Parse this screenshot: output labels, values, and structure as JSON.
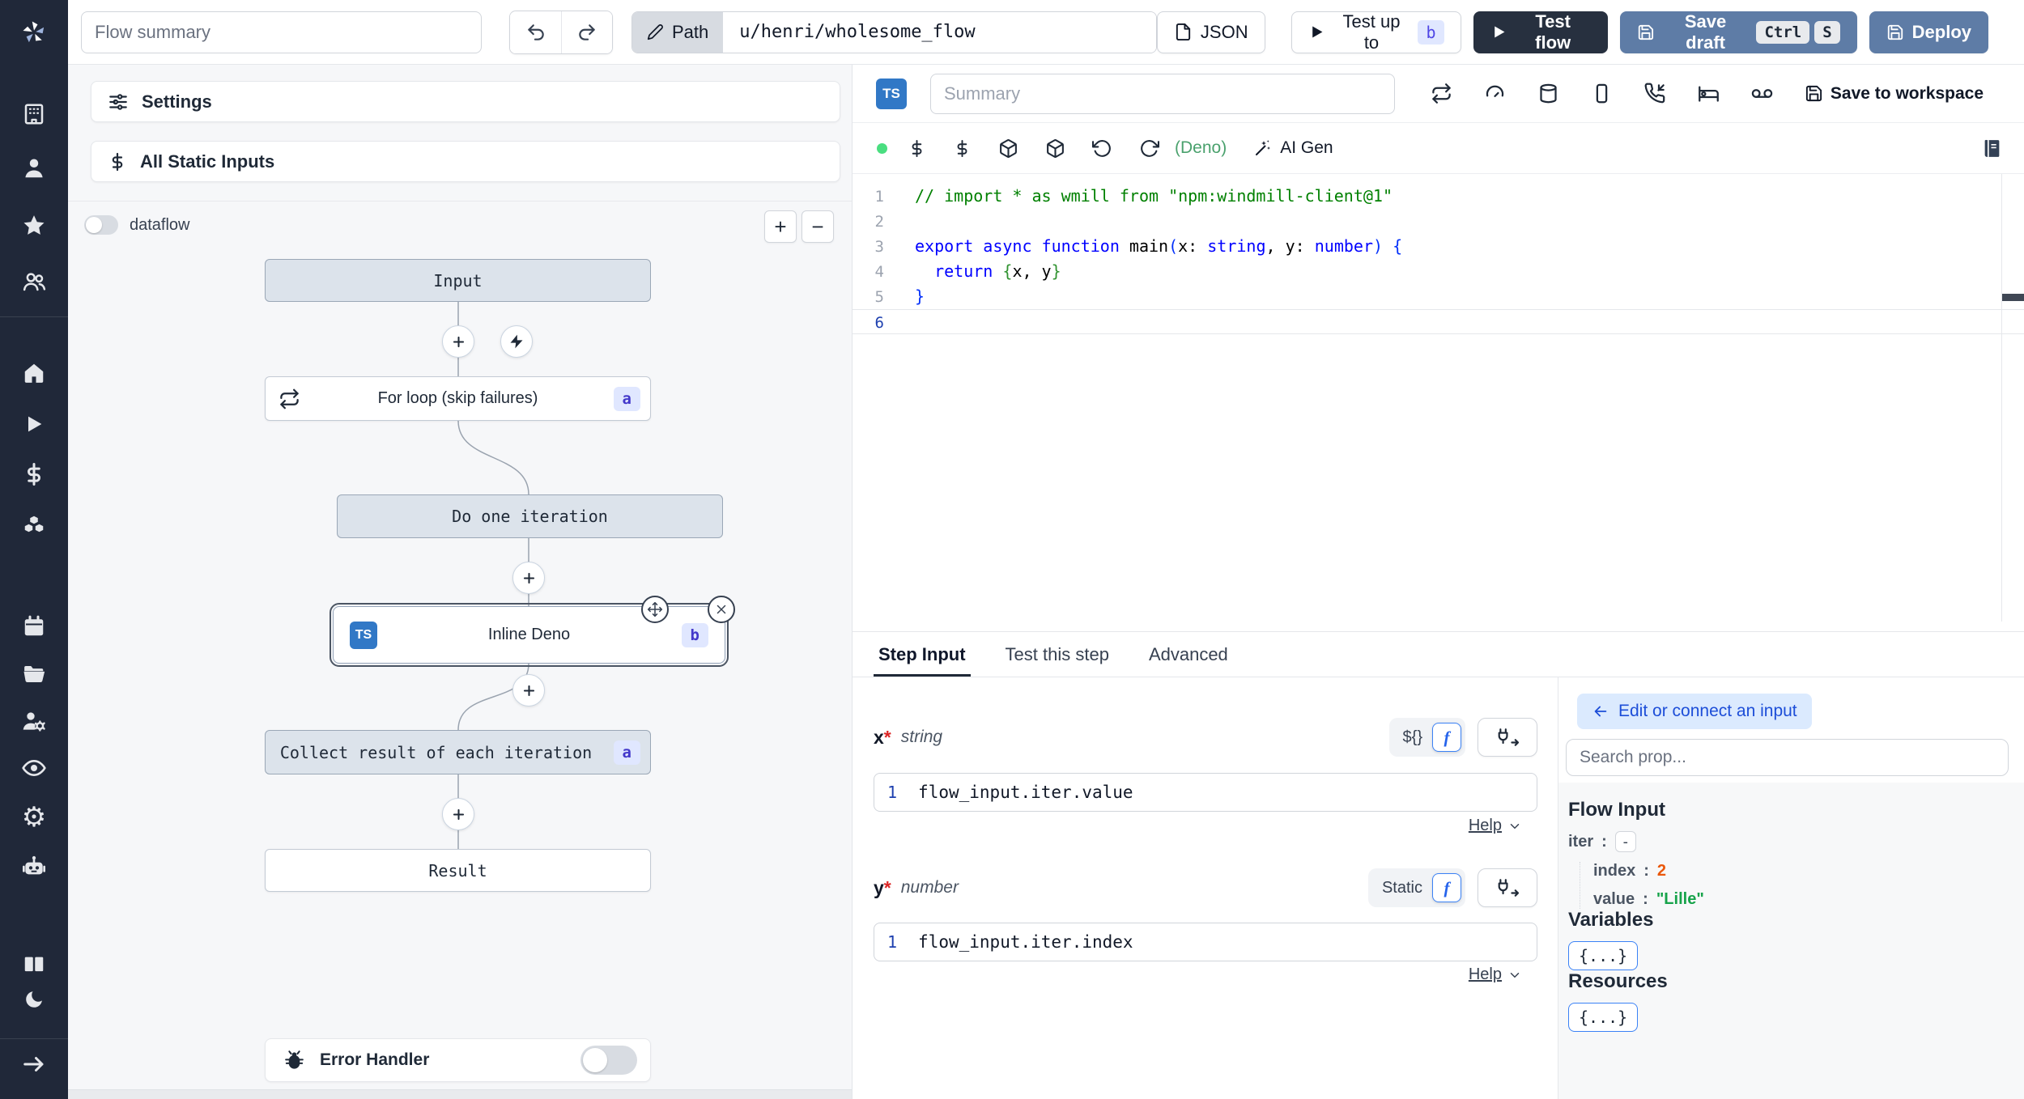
{
  "topbar": {
    "flow_summary_placeholder": "Flow summary",
    "path_label": "Path",
    "path_value": "u/henri/wholesome_flow",
    "json_button": "JSON",
    "test_up_to": "Test up to",
    "test_up_to_badge": "b",
    "test_flow": "Test flow",
    "save_draft": "Save draft",
    "kbd_ctrl": "Ctrl",
    "kbd_s": "S",
    "deploy": "Deploy"
  },
  "flow": {
    "settings_label": "Settings",
    "static_inputs_label": "All Static Inputs",
    "dataflow_label": "dataflow",
    "zoom_in": "+",
    "zoom_out": "−",
    "nodes": {
      "input": "Input",
      "forloop": "For loop (skip failures)",
      "forloop_badge": "a",
      "do_iteration": "Do one iteration",
      "inline_deno": "Inline Deno",
      "inline_deno_badge": "b",
      "inline_deno_lang": "TS",
      "collect": "Collect result of each iteration",
      "collect_badge": "a",
      "result": "Result"
    },
    "error_handler_label": "Error Handler"
  },
  "editor": {
    "lang_badge": "TS",
    "summary_placeholder": "Summary",
    "save_to_workspace": "Save to workspace",
    "runtime": "(Deno)",
    "ai_gen_label": "AI Gen",
    "line_numbers": [
      "1",
      "2",
      "3",
      "4",
      "5",
      "6"
    ],
    "tokens": {
      "l1_comment": "// import * as wmill from \"npm:windmill-client@1\"",
      "l3_kw": "export async function",
      "l3_name": " main",
      "l3_p1": "(",
      "l3_a1": "x: ",
      "l3_t1": "string",
      "l3_a2": ", y: ",
      "l3_t2": "number",
      "l3_p2": ") {",
      "l4_indent": "  ",
      "l4_kw": "return ",
      "l4_b1": "{",
      "l4_args": "x, y",
      "l4_b2": "}",
      "l5_b": "}"
    }
  },
  "step_panel": {
    "tabs": {
      "step_input": "Step Input",
      "test_this_step": "Test this step",
      "advanced": "Advanced"
    },
    "x_field": {
      "name": "x",
      "required": "*",
      "type": "string",
      "mode_alt": "${}",
      "mode_f": "f",
      "line_no": "1",
      "expr": "flow_input.iter.value",
      "help": "Help"
    },
    "y_field": {
      "name": "y",
      "required": "*",
      "type": "number",
      "mode_alt": "Static",
      "mode_f": "f",
      "line_no": "1",
      "expr": "flow_input.iter.index",
      "help": "Help"
    },
    "connect": {
      "edit_pill": "Edit or connect an input",
      "search_placeholder": "Search prop...",
      "flow_input_title": "Flow Input",
      "colon": ":",
      "iter_key": "iter",
      "iter_collapse": "-",
      "index_key": "index",
      "index_value": "2",
      "value_key": "value",
      "value_value": "\"Lille\"",
      "variables_title": "Variables",
      "variables_button": "{...}",
      "resources_title": "Resources",
      "resources_button": "{...}"
    }
  },
  "colors": {
    "sidebar_dark": "#202839",
    "accent_blue": "#3b82f6",
    "button_slate_blue": "#5e7ca6",
    "dark_button": "#27303f",
    "badge_indigo_bg": "#e0e7ff",
    "badge_indigo_text": "#4338ca",
    "ts_blue": "#3178c6",
    "status_green_dot": "#4ade80",
    "runtime_green": "#4aa16d",
    "code_comment_green": "#008000",
    "code_keyword_blue": "#0000ff",
    "tree_number_orange": "#ea580c",
    "tree_string_green": "#16a34a"
  }
}
